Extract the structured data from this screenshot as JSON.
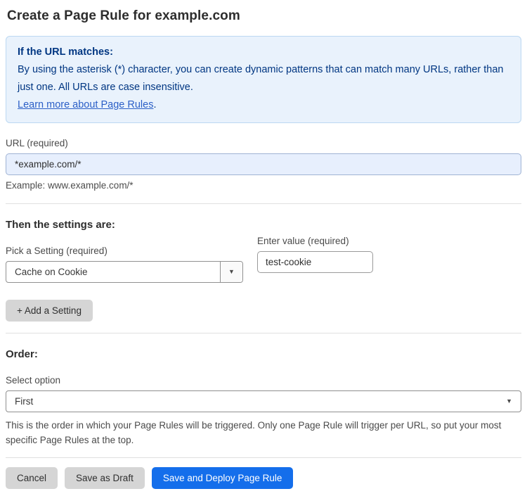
{
  "page": {
    "title": "Create a Page Rule for example.com"
  },
  "info_box": {
    "heading": "If the URL matches:",
    "body": "By using the asterisk (*) character, you can create dynamic patterns that can match many URLs, rather than just one. All URLs are case insensitive.",
    "link": "Learn more about Page Rules",
    "link_suffix": "."
  },
  "url_field": {
    "label": "URL (required)",
    "value": "*example.com/*",
    "helper": "Example: www.example.com/*"
  },
  "settings_section": {
    "heading": "Then the settings are:",
    "setting_label": "Pick a Setting (required)",
    "setting_value": "Cache on Cookie",
    "value_label": "Enter value (required)",
    "value_value": "test-cookie",
    "add_button_label": "+ Add a Setting"
  },
  "order_section": {
    "heading": "Order:",
    "select_label": "Select option",
    "select_value": "First",
    "helper": "This is the order in which your Page Rules will be triggered. Only one Page Rule will trigger per URL, so put your most specific Page Rules at the top."
  },
  "icons": {
    "dropdown_arrow": "▼"
  },
  "footer": {
    "cancel_label": "Cancel",
    "save_draft_label": "Save as Draft",
    "save_deploy_label": "Save and Deploy Page Rule"
  },
  "colors": {
    "primary_button_blue": "#146eeb",
    "info_box_bg": "#e9f2fc",
    "info_box_border": "#bcd8f2",
    "info_box_text": "#003682",
    "link_blue": "#2b5fc7",
    "url_input_bg": "#e7effd",
    "gray_button_bg": "#d5d5d5"
  }
}
